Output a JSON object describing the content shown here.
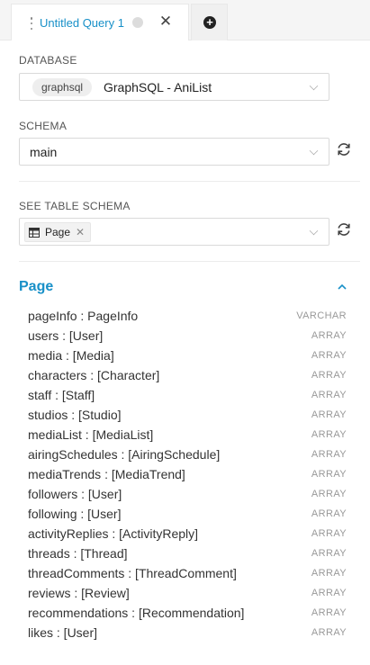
{
  "tab": {
    "title": "Untitled Query 1",
    "close_glyph": "✕",
    "add_glyph": "+"
  },
  "database": {
    "label": "DATABASE",
    "tag": "graphsql",
    "value": "GraphSQL - AniList"
  },
  "schema": {
    "label": "SCHEMA",
    "value": "main"
  },
  "table_schema": {
    "label": "SEE TABLE SCHEMA",
    "selected_tag": "Page",
    "remove_glyph": "✕"
  },
  "section": {
    "title": "Page",
    "fields": [
      {
        "name": "pageInfo : PageInfo",
        "type": "VARCHAR"
      },
      {
        "name": "users : [User]",
        "type": "ARRAY"
      },
      {
        "name": "media : [Media]",
        "type": "ARRAY"
      },
      {
        "name": "characters : [Character]",
        "type": "ARRAY"
      },
      {
        "name": "staff : [Staff]",
        "type": "ARRAY"
      },
      {
        "name": "studios : [Studio]",
        "type": "ARRAY"
      },
      {
        "name": "mediaList : [MediaList]",
        "type": "ARRAY"
      },
      {
        "name": "airingSchedules : [AiringSchedule]",
        "type": "ARRAY"
      },
      {
        "name": "mediaTrends : [MediaTrend]",
        "type": "ARRAY"
      },
      {
        "name": "followers : [User]",
        "type": "ARRAY"
      },
      {
        "name": "following : [User]",
        "type": "ARRAY"
      },
      {
        "name": "activityReplies : [ActivityReply]",
        "type": "ARRAY"
      },
      {
        "name": "threads : [Thread]",
        "type": "ARRAY"
      },
      {
        "name": "threadComments : [ThreadComment]",
        "type": "ARRAY"
      },
      {
        "name": "reviews : [Review]",
        "type": "ARRAY"
      },
      {
        "name": "recommendations : [Recommendation]",
        "type": "ARRAY"
      },
      {
        "name": "likes : [User]",
        "type": "ARRAY"
      }
    ]
  },
  "colors": {
    "accent": "#1890c8",
    "border": "#d9d9d9",
    "muted": "#999999"
  },
  "icons": [
    "drag-handle-icon",
    "unsaved-dot-icon",
    "close-icon",
    "add-icon",
    "chevron-down-icon",
    "refresh-icon",
    "table-icon",
    "chevron-up-icon"
  ]
}
